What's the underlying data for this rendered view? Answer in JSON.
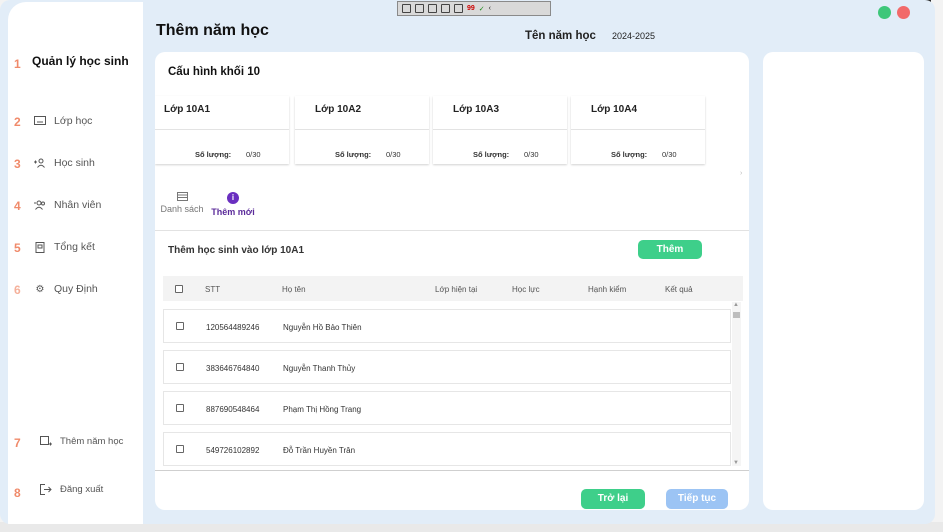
{
  "window": {
    "title": "Thêm năm học",
    "school_year_label": "Tên năm học",
    "school_year_value": "2024-2025"
  },
  "recorder_toolbar": {
    "count": "99"
  },
  "sidebar": {
    "brand": "Quản lý học sinh",
    "brand_number": "1",
    "items": [
      {
        "number": "2",
        "label": "Lớp học",
        "icon": "classroom-icon"
      },
      {
        "number": "3",
        "label": "Học sinh",
        "icon": "add-student-icon"
      },
      {
        "number": "4",
        "label": "Nhân viên",
        "icon": "staff-icon"
      },
      {
        "number": "5",
        "label": "Tổng kết",
        "icon": "summary-icon"
      },
      {
        "number": "6",
        "label": "Quy Định",
        "icon": "settings-gear-icon"
      }
    ],
    "bottom_items": [
      {
        "number": "7",
        "label": "Thêm năm học",
        "icon": "add-year-icon"
      },
      {
        "number": "8",
        "label": "Đăng xuất",
        "icon": "logout-icon"
      }
    ]
  },
  "main": {
    "section_title": "Cấu hình khối 10",
    "classes": [
      {
        "name": "Lớp 10A1",
        "quantity_label": "Số lượng:",
        "quantity": "0/30"
      },
      {
        "name": "Lớp 10A2",
        "quantity_label": "Số lượng:",
        "quantity": "0/30"
      },
      {
        "name": "Lớp 10A3",
        "quantity_label": "Số lượng:",
        "quantity": "0/30"
      },
      {
        "name": "Lớp 10A4",
        "quantity_label": "Số lượng:",
        "quantity": "0/30"
      }
    ],
    "tabs": [
      {
        "label": "Danh sách",
        "icon": "list-icon",
        "active": false
      },
      {
        "label": "Thêm mới",
        "icon": "info-icon",
        "active": true
      }
    ],
    "add_section_title": "Thêm học sinh vào lớp 10A1",
    "add_button": "Thêm",
    "table": {
      "headers": [
        "STT",
        "Họ tên",
        "Lớp hiện tại",
        "Học lực",
        "Hạnh kiểm",
        "Kết quả"
      ],
      "rows": [
        {
          "id": "120564489246",
          "name": "Nguyễn Hồ Bảo Thiên"
        },
        {
          "id": "383646764840",
          "name": "Nguyễn Thanh Thủy"
        },
        {
          "id": "887690548464",
          "name": "Phạm Thị Hồng Trang"
        },
        {
          "id": "549726102892",
          "name": "Đỗ Trần Huyền Trân"
        }
      ]
    },
    "back_button": "Trở lại",
    "next_button": "Tiếp tục"
  },
  "colors": {
    "background": "#e2edf8",
    "accent_green": "#3ecf8a",
    "accent_blue_disabled": "#9cc4f4",
    "nav_number": "#f08a6a",
    "active_tab": "#6a2fc0"
  }
}
